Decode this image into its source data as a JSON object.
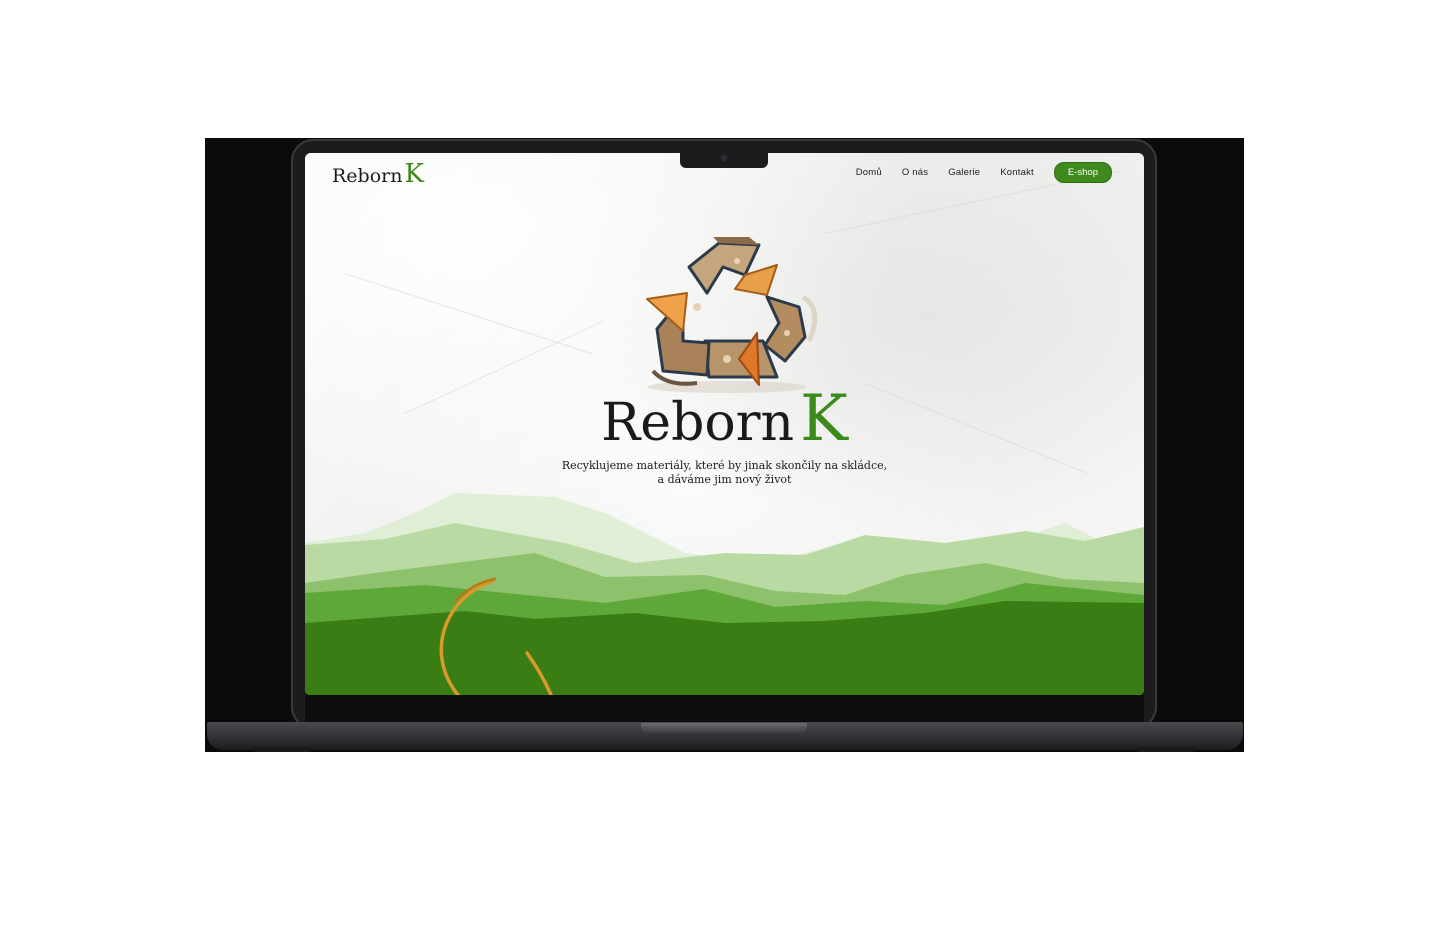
{
  "brand": {
    "name": "Reborn",
    "accent_letter": "K",
    "accent_color": "#3d8a1c"
  },
  "nav": {
    "items": [
      "Domů",
      "O nás",
      "Galerie",
      "Kontakt"
    ],
    "cta": "E-shop"
  },
  "hero": {
    "title": "Reborn",
    "title_accent": "K",
    "subtitle_line1": "Recyklujeme materiály, které by jinak skončily na skládce,",
    "subtitle_line2": "a dáváme jim nový život",
    "icon": "recycle-icon"
  },
  "colors": {
    "green_dark": "#3a7d14",
    "green_mid": "#5ea839",
    "green_light": "#a9d190",
    "arc": "#d99a2b",
    "laptop": "#1c1c1e"
  }
}
